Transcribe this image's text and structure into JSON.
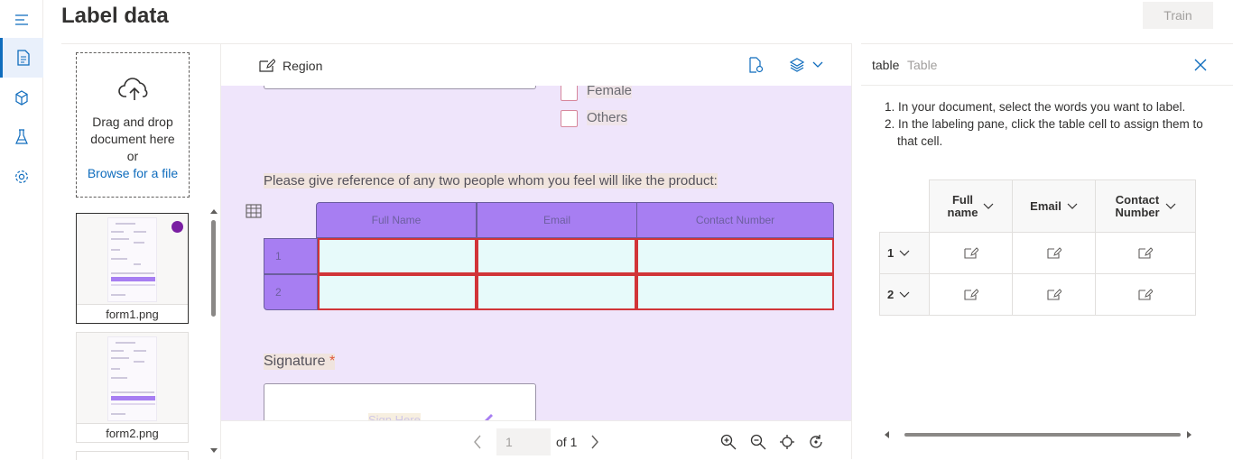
{
  "header": {
    "title": "Label data",
    "train_label": "Train"
  },
  "rail": {
    "items": [
      "menu-icon",
      "document-icon",
      "cube-icon",
      "flask-icon",
      "gear-icon"
    ]
  },
  "files": {
    "dropzone_line1": "Drag and drop",
    "dropzone_line2": "document here",
    "dropzone_or": "or",
    "browse_link": "Browse for a file",
    "items": [
      {
        "name": "form1.png"
      },
      {
        "name": "form2.png"
      }
    ]
  },
  "viewer": {
    "toolbar_region_label": "Region",
    "doc": {
      "checkbox_female": "Female",
      "checkbox_others": "Others",
      "reference_question": "Please give reference of any two people whom you feel will like the product:",
      "table_headers": [
        "Full Name",
        "Email",
        "Contact Number"
      ],
      "row_labels": [
        "1",
        "2"
      ],
      "signature_label": "Signature",
      "signature_required": "*",
      "signature_placeholder": "Sign Here"
    },
    "page_input_value": "1",
    "page_of": "of 1"
  },
  "label_panel": {
    "field_name": "table",
    "field_type": "Table",
    "instructions": [
      {
        "num": "1.",
        "text": "In your document, select the words you want to label."
      },
      {
        "num": "2.",
        "text": "In the labeling pane, click the table cell to assign them to"
      },
      {
        "num": "",
        "text": "that cell."
      }
    ],
    "columns": [
      {
        "line1": "Full",
        "line2": "name"
      },
      {
        "line1": "Email",
        "line2": ""
      },
      {
        "line1": "Contact",
        "line2": "Number"
      }
    ],
    "rows": [
      "1",
      "2"
    ]
  },
  "colors": {
    "accent": "#0f6cbd",
    "doc_bg": "#efe5fb",
    "table_header": "#a77ef2",
    "label_border": "#d13438",
    "cell_fill": "#e7fafa"
  }
}
